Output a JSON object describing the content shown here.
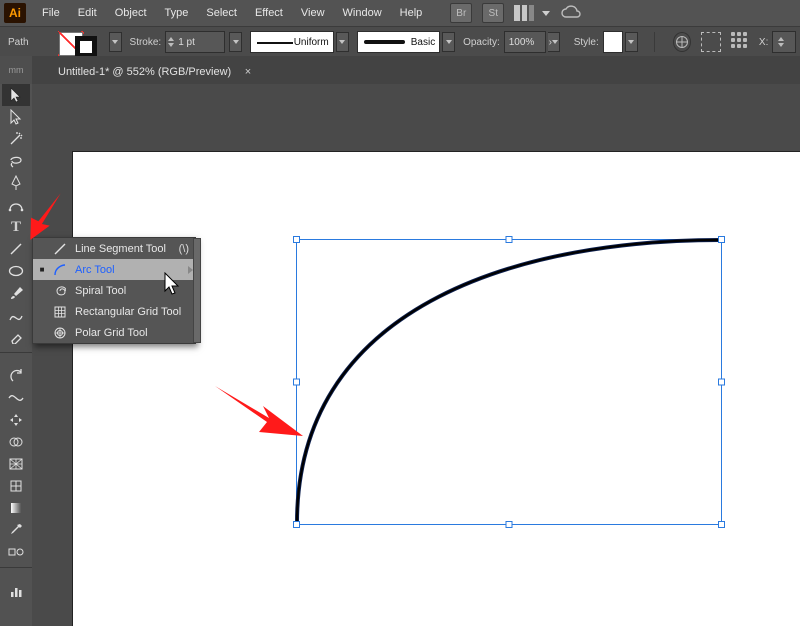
{
  "menu": {
    "items": [
      "File",
      "Edit",
      "Object",
      "Type",
      "Select",
      "Effect",
      "View",
      "Window",
      "Help"
    ],
    "br": "Br",
    "st": "St"
  },
  "ctrl": {
    "selection_label": "Path",
    "stroke_label": "Stroke:",
    "stroke_weight": "1 pt",
    "profile_label": "Uniform",
    "brush_label": "Basic",
    "opacity_label": "Opacity:",
    "opacity_value": "100%",
    "style_label": "Style:",
    "x_label": "X:"
  },
  "tab": {
    "title": "Untitled-1* @ 552% (RGB/Preview)",
    "close": "×"
  },
  "flyout": {
    "items": [
      {
        "label": "Line Segment Tool",
        "shortcut": "(\\)",
        "icon": "line"
      },
      {
        "label": "Arc Tool",
        "shortcut": "",
        "icon": "arc",
        "selected": true
      },
      {
        "label": "Spiral Tool",
        "shortcut": "",
        "icon": "spiral"
      },
      {
        "label": "Rectangular Grid Tool",
        "shortcut": "",
        "icon": "rectgrid"
      },
      {
        "label": "Polar Grid Tool",
        "shortcut": "",
        "icon": "polargrid"
      }
    ]
  },
  "tools": {
    "type_glyph": "T"
  },
  "ruler": {
    "corner": "mm"
  }
}
